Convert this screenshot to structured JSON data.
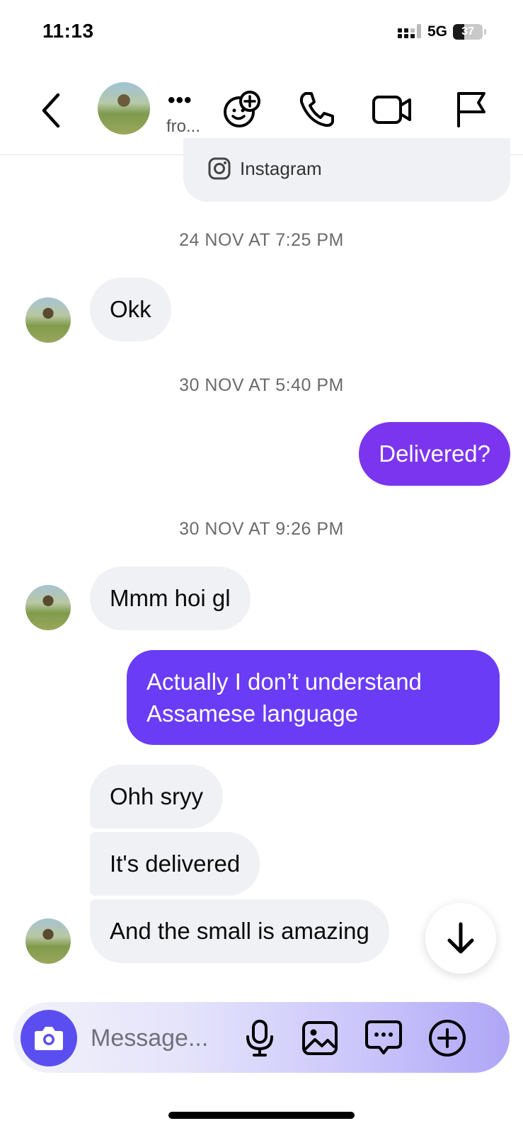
{
  "status_bar": {
    "time": "11:13",
    "network": "5G",
    "battery": "37"
  },
  "header": {
    "name_dots": "•••",
    "name_subtitle": "fro..."
  },
  "shared_card": {
    "source_label": "Instagram"
  },
  "colors": {
    "purple": "#7b35ef",
    "violet": "#6a3cf6",
    "camera_blue": "#5b4ef1",
    "incoming_bubble": "#eff1f4"
  },
  "messages": {
    "ts1": "24 NOV AT 7:25 PM",
    "m1": "Okk",
    "ts2": "30 NOV AT 5:40 PM",
    "m2": "Delivered?",
    "ts3": "30 NOV AT 9:26 PM",
    "m3": "Mmm hoi gl",
    "m4_line1": "Actually I don’t understand",
    "m4_line2": "Assamese language",
    "m5": "Ohh sryy",
    "m6": "It's delivered",
    "m7": "And the small is amazing"
  },
  "composer": {
    "placeholder": "Message..."
  },
  "icons": [
    "back-chevron-icon",
    "sticker-add-icon",
    "phone-icon",
    "video-camera-icon",
    "flag-icon",
    "instagram-icon",
    "arrow-down-icon",
    "camera-icon",
    "microphone-icon",
    "image-icon",
    "chat-bubble-icon",
    "plus-circle-icon"
  ]
}
